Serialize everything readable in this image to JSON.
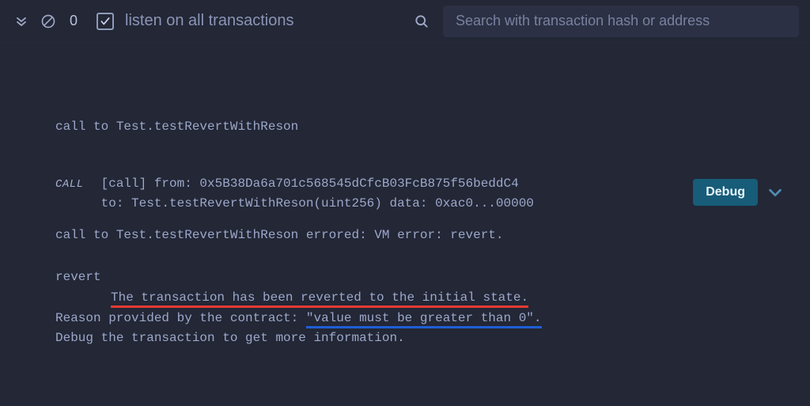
{
  "topbar": {
    "count": "0",
    "listen_label": "listen on all transactions",
    "search_placeholder": "Search with transaction hash or address"
  },
  "tx": {
    "header": "call to Test.testRevertWithReson",
    "badge": "CALL",
    "line_from": "[call]  from: 0x5B38Da6a701c568545dCfcB03FcB875f56beddC4",
    "line_to": "to: Test.testRevertWithReson(uint256) data: 0xac0...00000",
    "error": "call to Test.testRevertWithReson errored: VM error: revert.",
    "revert_word": "revert",
    "reverted_state": "The transaction has been reverted to the initial state.",
    "reason_prefix": "Reason provided by the contract: ",
    "reason_value": "\"value must be greater than 0\".",
    "debug_hint": "Debug the transaction to get more information.",
    "debug_btn": "Debug"
  }
}
